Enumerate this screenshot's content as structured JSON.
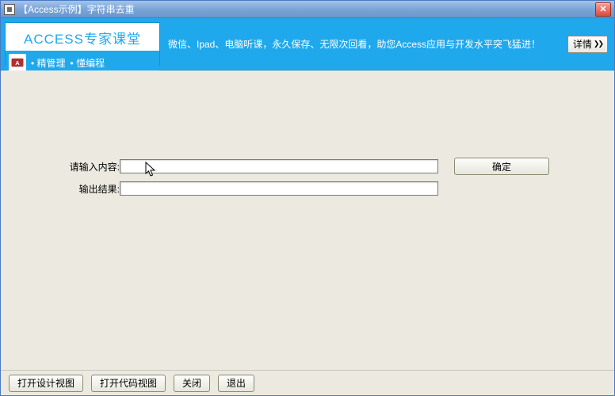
{
  "titlebar": {
    "title": "【Access示例】字符串去重"
  },
  "banner": {
    "card_title": "ACCESS专家课堂",
    "card_sub_left": "• 精管理",
    "card_sub_right": "• 懂编程",
    "promo_text": "微信、Ipad、电脑听课，永久保存、无限次回看，助您Access应用与开发水平突飞猛进！",
    "detail_label": "详情",
    "detail_arrows": "❯❯"
  },
  "form": {
    "input_label": "请输入内容:",
    "output_label": "输出结果:",
    "input_value": "",
    "output_value": "",
    "ok_label": "确定"
  },
  "footer": {
    "open_design_label": "打开设计视图",
    "open_code_label": "打开代码视图",
    "close_label": "关闭",
    "exit_label": "退出"
  }
}
